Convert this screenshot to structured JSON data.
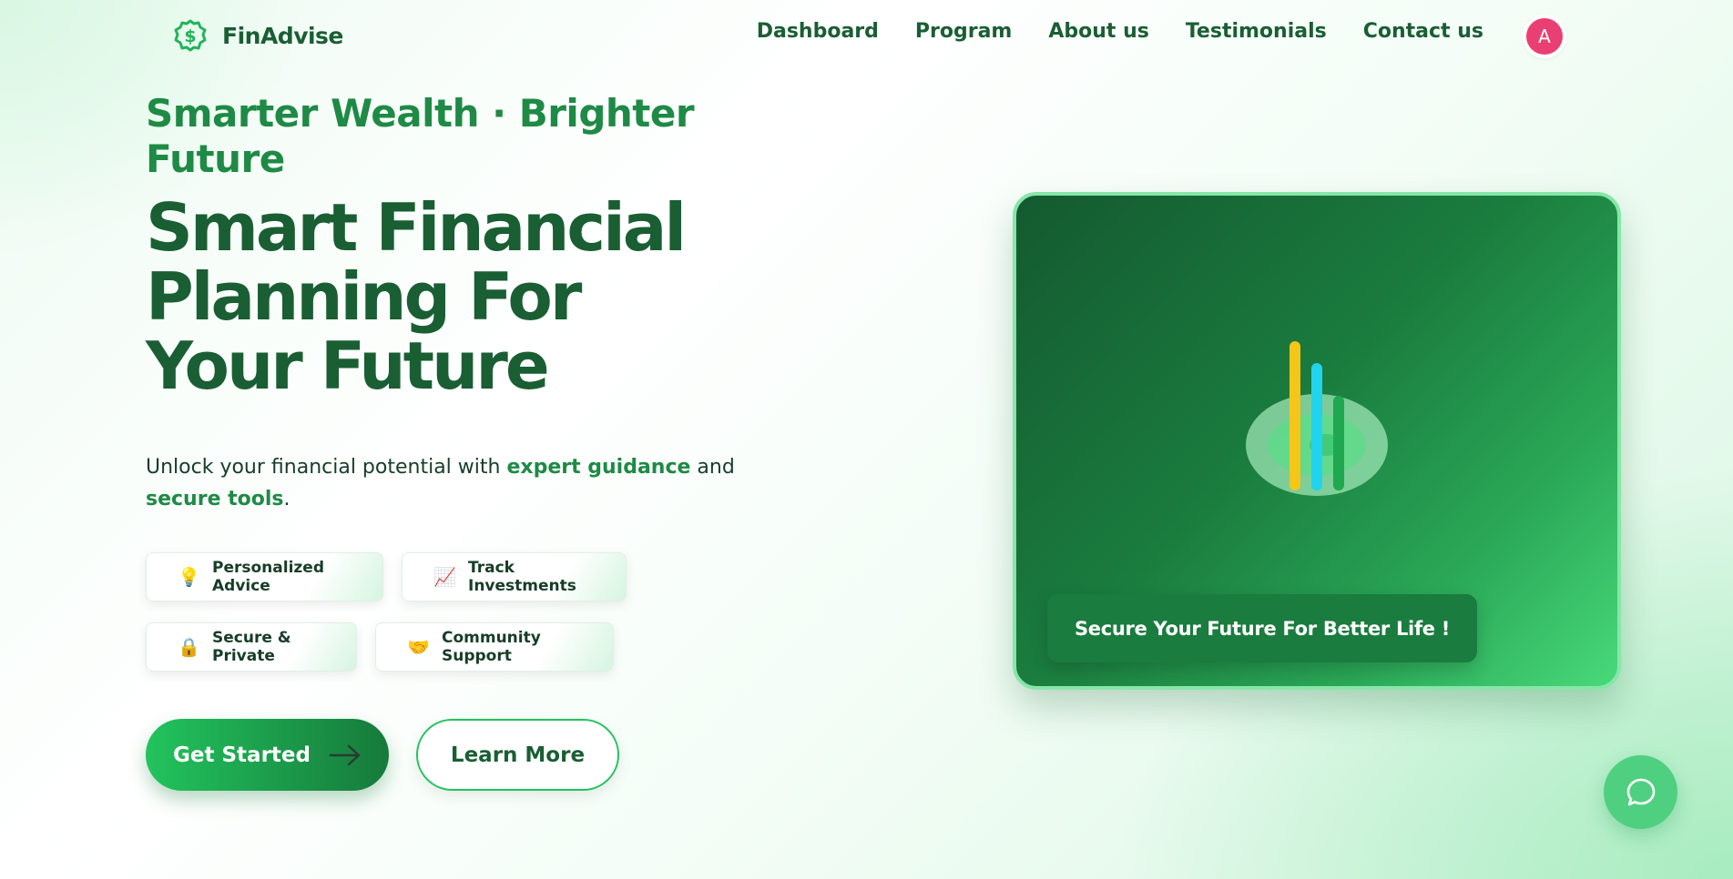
{
  "nav": {
    "brand": "FinAdvise",
    "brand_icon": "dollar-circle-icon",
    "menu": [
      "Dashboard",
      "Program",
      "About us",
      "Testimonials",
      "Contact us"
    ],
    "avatar_initial": "A"
  },
  "hero": {
    "tagline": "Smarter Wealth · Brighter Future",
    "headline": "Smart Financial Planning For Your Future",
    "subtext": {
      "part1": "Unlock your financial potential with ",
      "highlight1": "expert guidance",
      "part2": " and ",
      "highlight2": "secure tools",
      "part3": "."
    },
    "features": [
      {
        "icon": "💡",
        "icon_name": "lightbulb-icon",
        "label": "Personalized Advice"
      },
      {
        "icon": "📈",
        "icon_name": "chart-increasing-icon",
        "label": "Track Investments"
      },
      {
        "icon": "🔒",
        "icon_name": "lock-icon",
        "label": "Secure & Private"
      },
      {
        "icon": "🤝",
        "icon_name": "handshake-icon",
        "label": "Community Support"
      }
    ],
    "primary_button": "Get Started",
    "secondary_button": "Learn More"
  },
  "card": {
    "banner": "Secure Your Future For Better Life !",
    "illustration": "growth-bars-illustration"
  },
  "chat": {
    "icon": "chat-bubble-icon"
  },
  "colors": {
    "primary": "#1e8a45",
    "dark": "#1a5e34",
    "accent_yellow": "#f5c518",
    "accent_cyan": "#22d3ee",
    "avatar": "#ea3f72"
  }
}
